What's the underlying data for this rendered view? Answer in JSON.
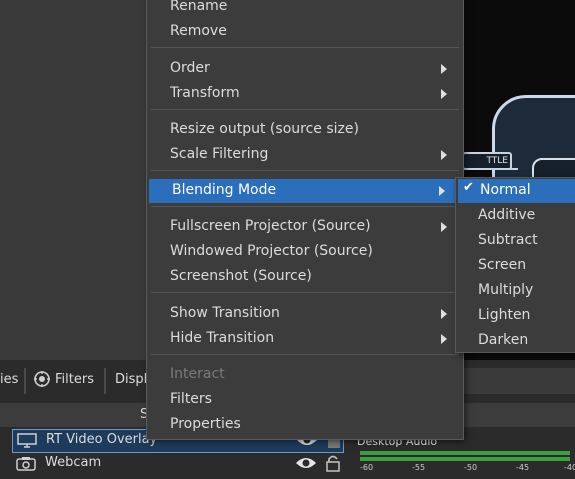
{
  "toolbar": {
    "left_fragment": "ies",
    "filters_label": "Filters",
    "display_fragment": "Displa"
  },
  "panels": {
    "sources_header_fragment": "S"
  },
  "sources": [
    {
      "label": "RT Video Overlay",
      "icon": "monitor-icon",
      "selected": true
    },
    {
      "label": "Webcam",
      "icon": "camera-icon",
      "selected": false
    }
  ],
  "mixer": {
    "channel": "Desktop Audio",
    "ticks": [
      "-60",
      "-55",
      "-50",
      "-45",
      "-40"
    ]
  },
  "preview": {
    "text_fragment": "TTLE"
  },
  "context_menu": {
    "items": [
      {
        "label": "Rename"
      },
      {
        "label": "Remove"
      },
      {
        "label": "Order"
      },
      {
        "label": "Transform"
      },
      {
        "label": "Resize output (source size)"
      },
      {
        "label": "Scale Filtering"
      },
      {
        "label": "Blending Mode"
      },
      {
        "label": "Fullscreen Projector (Source)"
      },
      {
        "label": "Windowed Projector (Source)"
      },
      {
        "label": "Screenshot (Source)"
      },
      {
        "label": "Show Transition"
      },
      {
        "label": "Hide Transition"
      },
      {
        "label": "Interact"
      },
      {
        "label": "Filters"
      },
      {
        "label": "Properties"
      }
    ]
  },
  "blending_submenu": {
    "check_mark": "✔",
    "items": [
      "Normal",
      "Additive",
      "Subtract",
      "Screen",
      "Multiply",
      "Lighten",
      "Darken"
    ],
    "selected": "Normal"
  },
  "colors": {
    "highlight": "#2a6ebc",
    "menu_bg": "#3c3c3c",
    "selection_border": "#6a9ad0"
  }
}
